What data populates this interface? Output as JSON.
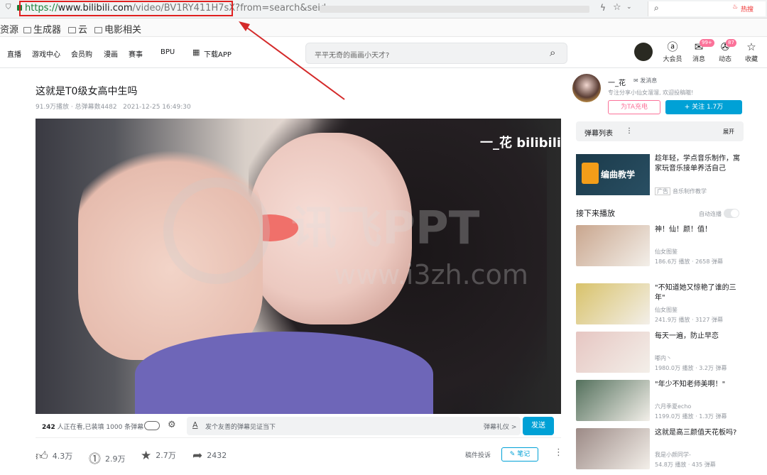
{
  "browser": {
    "url_scheme": "https://",
    "url_domain": "www.bilibili.com",
    "url_path": "/video/BV1RY411H7sX?",
    "url_query": "from=search&seid",
    "hot_label": "热搜"
  },
  "bookmarks": [
    "资源",
    "生成器",
    "云",
    "电影相关"
  ],
  "nav": {
    "items": [
      "直播",
      "游戏中心",
      "会员购",
      "漫画",
      "赛事",
      "BPU",
      "下载APP"
    ],
    "search_placeholder": "平平无奇的画画小天才?",
    "right": [
      {
        "label": "大会员",
        "icon": "vip-icon",
        "badge": ""
      },
      {
        "label": "消息",
        "icon": "message-icon",
        "badge": "99+"
      },
      {
        "label": "动态",
        "icon": "dynamic-icon",
        "badge": "87"
      },
      {
        "label": "收藏",
        "icon": "star-icon",
        "badge": ""
      }
    ]
  },
  "video": {
    "title": "这就是T0级女高中生吗",
    "plays": "91.9万播放",
    "danmaku_total": "总弹幕数4482",
    "date": "2021-12-25 16:49:30",
    "logo": "一_花 bilibili",
    "watermark_big": "讯飞PPT",
    "watermark_url": "www.i3zh.com"
  },
  "danmaku_bar": {
    "watching_count": "242",
    "watching_text": "人正在看,已装填 1000 条弹幕",
    "placeholder": "发个友善的弹幕见证当下",
    "etiquette": "弹幕礼仪 >",
    "send": "发送"
  },
  "actions": {
    "like": "4.3万",
    "coin": "2.9万",
    "fav": "2.7万",
    "share": "2432",
    "report": "稿件投诉",
    "note": "笔记"
  },
  "uploader": {
    "name": "一_花",
    "message": "发消息",
    "desc": "专注分享小仙女溜溜, 欢迎投稿嗷!",
    "charge": "为TA充电",
    "follow": "+ 关注 1.7万"
  },
  "danmaku_list": {
    "title": "弹幕列表",
    "expand": "展开"
  },
  "ad": {
    "image_text": "编曲教学",
    "title": "趁年轻，学点音乐制作，寓家玩音乐接单养活自己",
    "tag": "广告",
    "channel": "音乐制作教学"
  },
  "next": {
    "title": "接下来播放",
    "autoplay": "自动连播"
  },
  "recommendations": [
    {
      "title": "神！仙！颜！值！",
      "author": "仙女图鉴",
      "plays": "186.6万 播放",
      "danmaku": "2658 弹幕",
      "color": "#c9a68e"
    },
    {
      "title": "\"不知道她又惊艳了谁的三年\"",
      "author": "仙女图鉴",
      "plays": "241.9万 播放",
      "danmaku": "3127 弹幕",
      "color": "#d8c26a"
    },
    {
      "title": "每天一遍，防止早恋",
      "author": "嘟内丶",
      "plays": "1980.0万 播放",
      "danmaku": "3.2万 弹幕",
      "color": "#e6c6c2"
    },
    {
      "title": "\"年少不知老师美啊！\"",
      "author": "六月季夏echo",
      "plays": "1199.0万 播放",
      "danmaku": "1.3万 弹幕",
      "color": "#53705c"
    },
    {
      "title": "这就是高三颜值天花板吗?",
      "author": "我是小颜同学-",
      "plays": "54.8万 播放",
      "danmaku": "435 弹幕",
      "color": "#9c8a86"
    }
  ]
}
